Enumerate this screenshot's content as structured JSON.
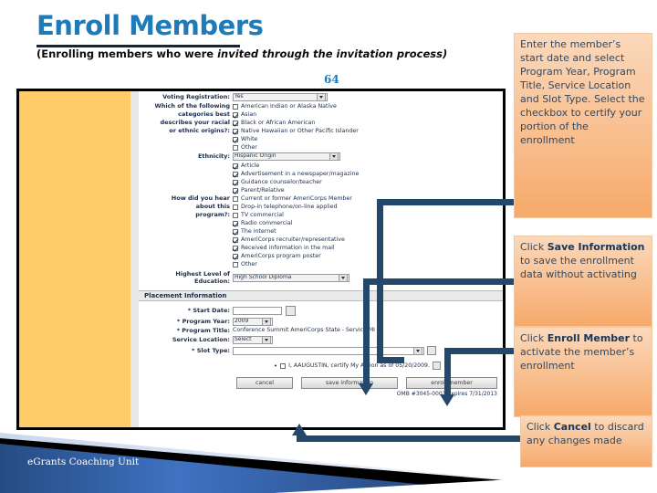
{
  "slide": {
    "title": "Enroll Members",
    "subtitle_plain": "(Enrolling members who were ",
    "subtitle_italic": "invited through the invitation process)",
    "page_number": "64",
    "footer": "eGrants Coaching Unit",
    "accent_blue": "#1F7AB8",
    "connector_blue": "#24486B",
    "callout_orange": "#F6A96A",
    "panel_yellow": "#FFCB69"
  },
  "screenshot": {
    "fields": {
      "voting_label": "Voting Registration:",
      "voting_value": "Yes",
      "race_label_l1": "Which of the following",
      "race_label_l2": "categories   best",
      "race_label_l3": "describes your racial",
      "race_label_l4": "or   ethnic origins?:",
      "ethnicity_label": "Ethnicity:",
      "ethnicity_value": "Hispanic Origin",
      "hear_label_l1": "How did you hear",
      "hear_label_l2": "about this",
      "hear_label_l3": "program?:",
      "education_label_l1": "Highest Level of",
      "education_label_l2": "Education:",
      "education_value": "High School Diploma"
    },
    "race_options": [
      {
        "label": "American Indian or Alaska Native",
        "checked": false
      },
      {
        "label": "Asian",
        "checked": true
      },
      {
        "label": "Black or African American",
        "checked": true
      },
      {
        "label": "Native Hawaiian or Other Pacific Islander",
        "checked": true
      },
      {
        "label": "White",
        "checked": true
      },
      {
        "label": "Other",
        "checked": false
      }
    ],
    "hear_options": [
      {
        "label": "Article",
        "checked": true
      },
      {
        "label": "Advertisement in a newspaper/magazine",
        "checked": true
      },
      {
        "label": "Guidance counselor/teacher",
        "checked": true
      },
      {
        "label": "Parent/Relative",
        "checked": true
      },
      {
        "label": "Current or former AmeriCorps Member",
        "checked": false
      },
      {
        "label": "Drop-in telephone/on-line applied",
        "checked": false
      },
      {
        "label": "TV commercial",
        "checked": false
      },
      {
        "label": "Radio commercial",
        "checked": true
      },
      {
        "label": "The internet",
        "checked": true
      },
      {
        "label": "AmeriCorps recruiter/representative",
        "checked": true
      },
      {
        "label": "Received information in the mail",
        "checked": true
      },
      {
        "label": "AmeriCorps program poster",
        "checked": true
      },
      {
        "label": "Other",
        "checked": false
      }
    ],
    "placement": {
      "section_title": "Placement Information",
      "start_date_label": "* Start Date:",
      "start_date_value": "",
      "calendar_icon": "calendar-icon",
      "program_year_label": "* Program Year:",
      "program_year_value": "2009",
      "program_title_label": "* Program Title:",
      "program_title_value": "Conference Summit AmeriCorps State - Service MI",
      "service_location_label": "Service Location:",
      "service_location_value": "Select",
      "slot_type_label": "* Slot Type:",
      "slot_type_value": ""
    },
    "certification": "I, AAUGUSTIN, certify My Action as of 05/20/2009.",
    "buttons": {
      "cancel": "cancel",
      "save": "save information",
      "enroll": "enroll member"
    },
    "omb": "OMB #3045-0003 Expires 7/31/2013"
  },
  "callouts": [
    {
      "id": "co1",
      "name": "callout-enter-start-date",
      "text": "Enter the member’s start date and select Program Year, Program Title, Service Location and Slot Type. Select the checkbox to certify your portion of the enrollment"
    },
    {
      "id": "co2",
      "name": "callout-save-information",
      "pre": "Click ",
      "bold": "Save Information",
      "post": " to save the enrollment data without activating"
    },
    {
      "id": "co3",
      "name": "callout-enroll-member",
      "pre": "Click ",
      "bold": "Enroll Member",
      "post": " to activate the member’s enrollment"
    },
    {
      "id": "co4",
      "name": "callout-cancel",
      "pre": "Click ",
      "bold": "Cancel",
      "post": " to discard any changes made"
    }
  ]
}
